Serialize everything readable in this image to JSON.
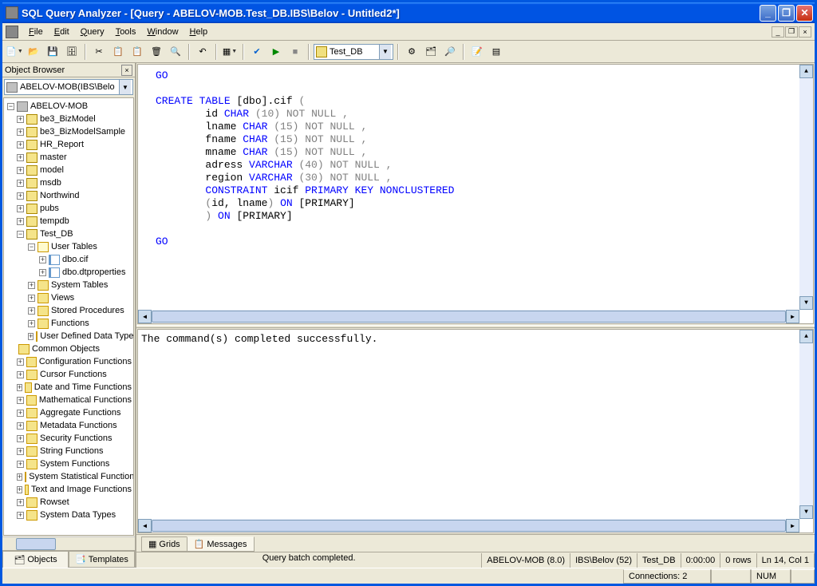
{
  "window": {
    "title": "SQL Query Analyzer - [Query - ABELOV-MOB.Test_DB.IBS\\Belov - Untitled2*]"
  },
  "menu": {
    "file": "File",
    "edit": "Edit",
    "query": "Query",
    "tools": "Tools",
    "window": "Window",
    "help": "Help"
  },
  "toolbar": {
    "db_selected": "Test_DB"
  },
  "browser": {
    "title": "Object Browser",
    "combo": "ABELOV-MOB(IBS\\Belo",
    "server": "ABELOV-MOB",
    "dbs": [
      "be3_BizModel",
      "be3_BizModelSample",
      "HR_Report",
      "master",
      "model",
      "msdb",
      "Northwind",
      "pubs",
      "tempdb"
    ],
    "test_db": "Test_DB",
    "user_tables": "User Tables",
    "tables": [
      "dbo.cif",
      "dbo.dtproperties"
    ],
    "db_folders": [
      "System Tables",
      "Views",
      "Stored Procedures",
      "Functions",
      "User Defined Data Types"
    ],
    "common": "Common Objects",
    "common_items": [
      "Configuration Functions",
      "Cursor Functions",
      "Date and Time Functions",
      "Mathematical Functions",
      "Aggregate Functions",
      "Metadata Functions",
      "Security Functions",
      "String Functions",
      "System Functions",
      "System Statistical Functions",
      "Text and Image Functions",
      "Rowset",
      "System Data Types"
    ],
    "tab_objects": "Objects",
    "tab_templates": "Templates"
  },
  "sql": {
    "go1": "GO",
    "create": "CREATE",
    "table": "TABLE",
    "dbo_cif": " [dbo].cif ",
    "lp": "(",
    "id": "id ",
    "char": "CHAR",
    "p10": " (10) ",
    "notnull": "NOT NULL",
    "comma": " ,",
    "lname": "lname ",
    "p15": " (15) ",
    "fname": "fname ",
    "mname": "mname ",
    "adress": "adress ",
    "varchar": "VARCHAR",
    "p40": " (40) ",
    "region": "region ",
    "p30": " (30) ",
    "constraint": "CONSTRAINT",
    "icif": " icif ",
    "pk": "PRIMARY KEY NONCLUSTERED",
    "idlname_open": "(",
    "idlname": "id, lname",
    "idlname_close": ") ",
    "on": "ON",
    "primary": " [PRIMARY]",
    "rp": ") ",
    "go2": "GO"
  },
  "results": {
    "message": "The command(s) completed successfully."
  },
  "result_tabs": {
    "grids": "Grids",
    "messages": "Messages"
  },
  "status": {
    "message": "Query batch completed.",
    "server": "ABELOV-MOB (8.0)",
    "user": "IBS\\Belov (52)",
    "db": "Test_DB",
    "time": "0:00:00",
    "rows": "0 rows",
    "pos": "Ln 14, Col 1"
  },
  "appstatus": {
    "connections": "Connections: 2",
    "num": "NUM"
  }
}
